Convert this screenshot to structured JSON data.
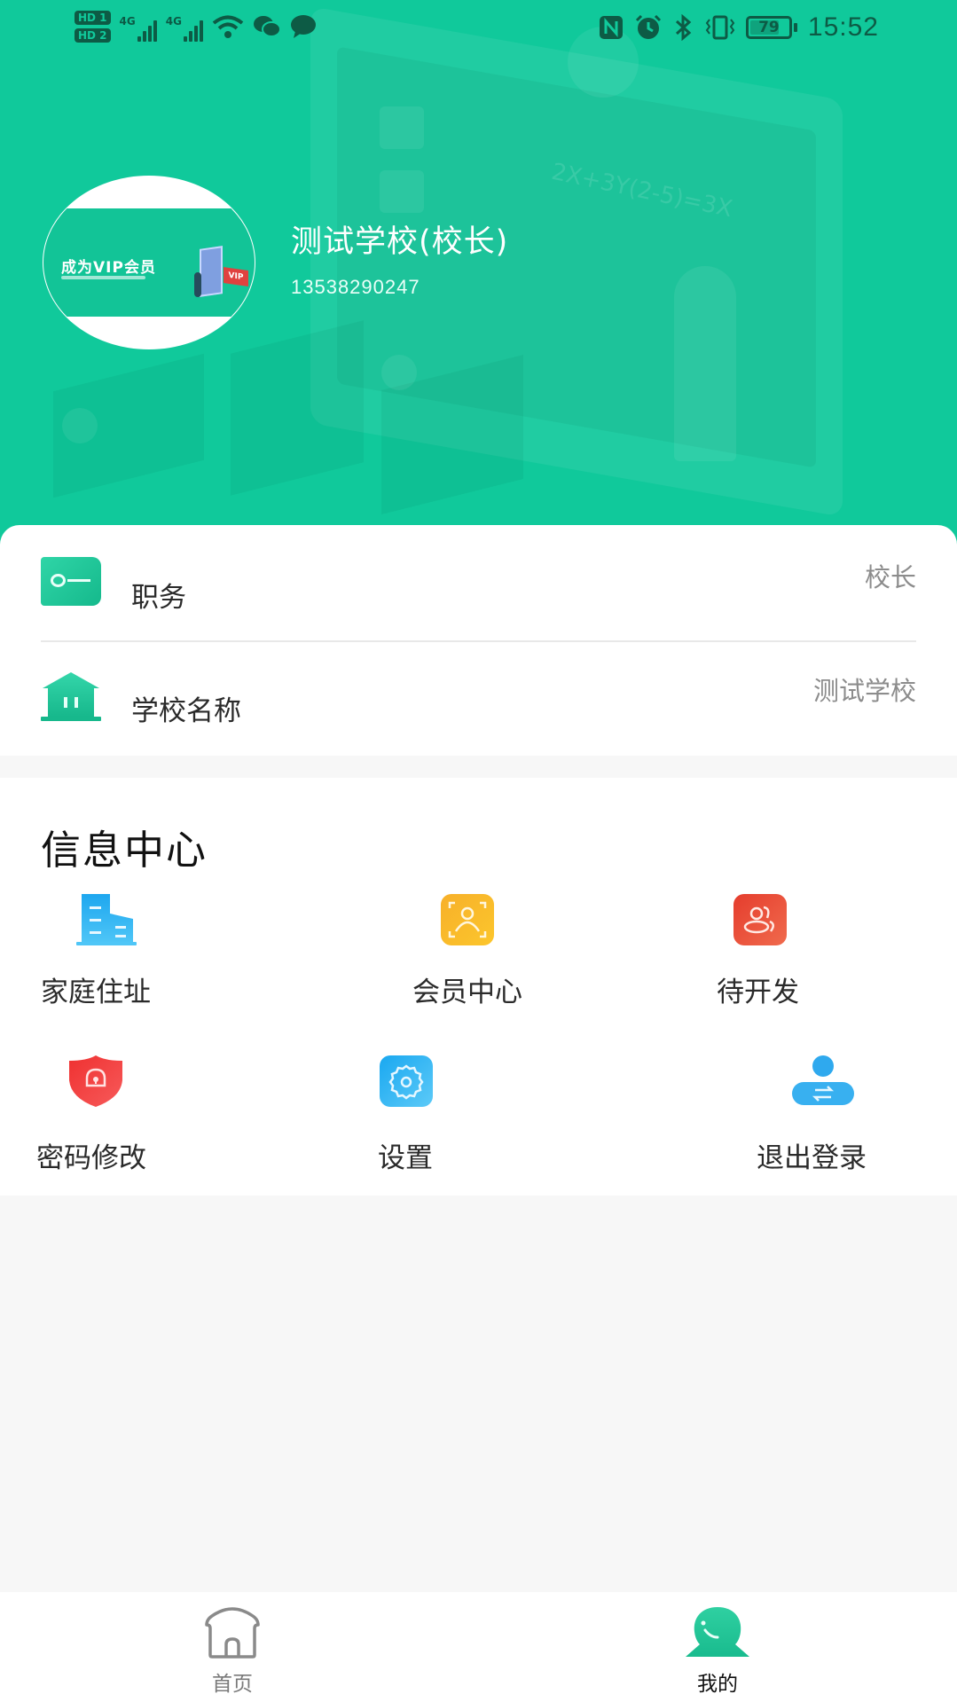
{
  "status_bar": {
    "sim1": "HD 1",
    "sim2": "HD 2",
    "network1": "4G",
    "network2": "4G",
    "icons_left": [
      "hd-sim1-icon",
      "hd-sim2-icon",
      "signal-4g-icon",
      "signal-4g-icon",
      "wifi-icon",
      "wechat-icon",
      "message-icon"
    ],
    "icons_right": [
      "nfc-icon",
      "alarm-icon",
      "bluetooth-icon",
      "vibrate-icon",
      "battery-icon"
    ],
    "battery": "79",
    "time": "15:52"
  },
  "profile": {
    "avatar_banner_title": "成为VIP会员",
    "avatar_badge": "VIP",
    "name": "测试学校(校长)",
    "phone": "13538290247"
  },
  "info_rows": [
    {
      "icon": "key-icon",
      "label": "职务",
      "value": "校长"
    },
    {
      "icon": "school-building-icon",
      "label": "学校名称",
      "value": "测试学校"
    }
  ],
  "info_center": {
    "title": "信息中心",
    "items": [
      {
        "icon": "building-icon",
        "label": "家庭住址",
        "color": "#29b6f6"
      },
      {
        "icon": "member-face-icon",
        "label": "会员中心",
        "color": "#fbb829"
      },
      {
        "icon": "group-users-icon",
        "label": "待开发",
        "color": "#ea4a33"
      },
      {
        "icon": "lock-shield-icon",
        "label": "密码修改",
        "color": "#f23d3d"
      },
      {
        "icon": "gear-icon",
        "label": "设置",
        "color": "#33b5f5"
      },
      {
        "icon": "switch-user-icon",
        "label": "退出登录",
        "color": "#38b0f0"
      }
    ]
  },
  "bottom_nav": {
    "items": [
      {
        "icon": "home-icon",
        "label": "首页",
        "active": false
      },
      {
        "icon": "profile-icon",
        "label": "我的",
        "active": true
      }
    ]
  },
  "colors": {
    "brand": "#10c99b",
    "text_primary": "#2a2a2a",
    "text_secondary": "#8c8c8c",
    "nav_inactive": "#7a7a7a"
  }
}
